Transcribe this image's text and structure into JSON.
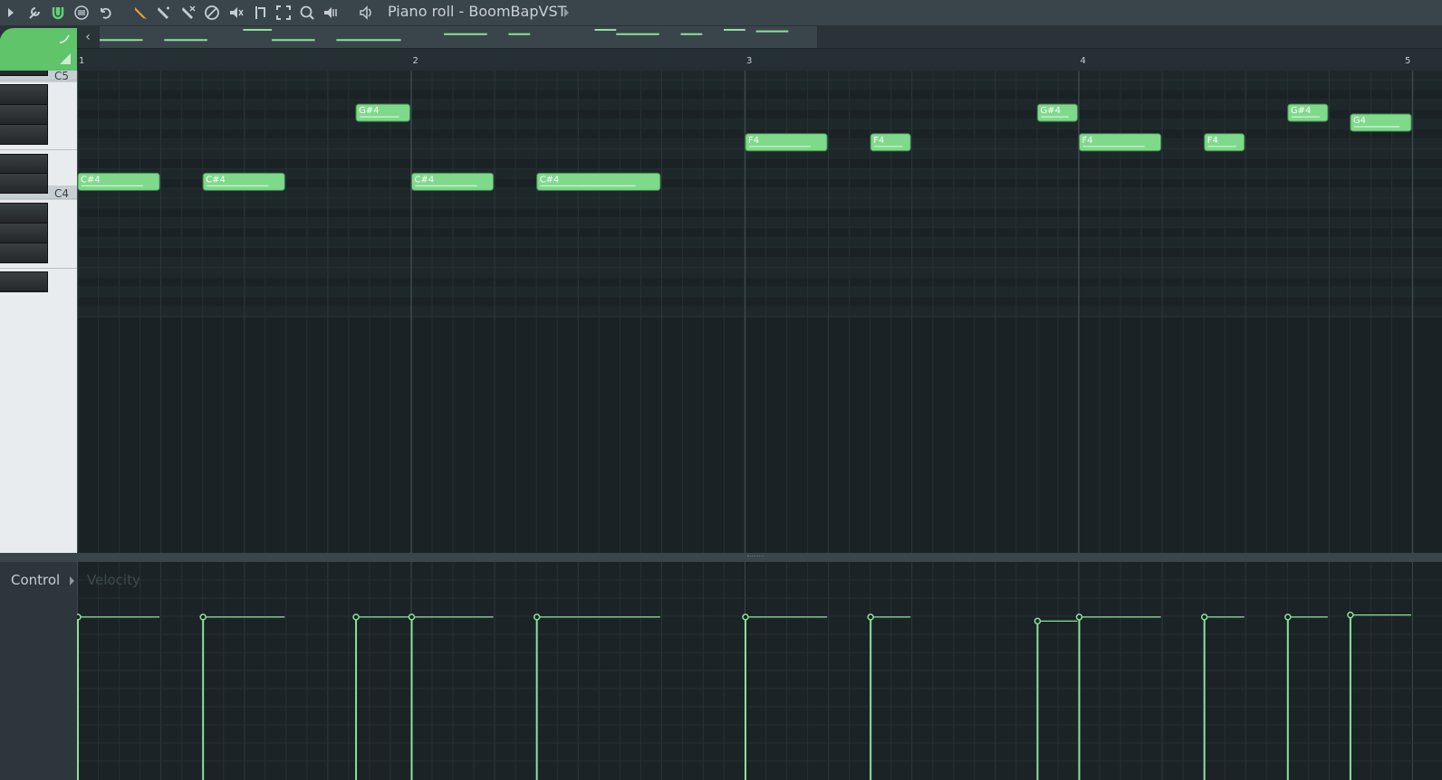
{
  "window": {
    "title": "Piano roll - BoomBapVST"
  },
  "toolbar": {
    "buttons": [
      {
        "name": "menu-arrow-icon"
      },
      {
        "name": "wrench-icon"
      },
      {
        "name": "magnet-icon"
      },
      {
        "name": "options-icon"
      },
      {
        "name": "undo-icon"
      },
      {
        "name": "pencil-icon"
      },
      {
        "name": "paint-icon"
      },
      {
        "name": "delete-icon"
      },
      {
        "name": "disable-icon"
      },
      {
        "name": "mute-icon"
      },
      {
        "name": "slice-icon"
      },
      {
        "name": "select-icon"
      },
      {
        "name": "zoom-icon"
      },
      {
        "name": "playback-icon"
      },
      {
        "name": "speaker-icon"
      }
    ]
  },
  "ruler": {
    "bars": [
      "1",
      "2",
      "3",
      "4",
      "5"
    ]
  },
  "keyboard": {
    "labels": [
      "C5",
      "C4"
    ]
  },
  "notes": [
    {
      "label": "C#4",
      "pitch": 61,
      "start": 0.0,
      "length": 0.25,
      "velocity": 0.8
    },
    {
      "label": "C#4",
      "pitch": 61,
      "start": 0.375,
      "length": 0.25,
      "velocity": 0.8
    },
    {
      "label": "G#4",
      "pitch": 68,
      "start": 0.8333,
      "length": 0.1667,
      "velocity": 0.8
    },
    {
      "label": "C#4",
      "pitch": 61,
      "start": 1.0,
      "length": 0.25,
      "velocity": 0.8
    },
    {
      "label": "C#4",
      "pitch": 61,
      "start": 1.375,
      "length": 0.375,
      "velocity": 0.8
    },
    {
      "label": "F4",
      "pitch": 65,
      "start": 2.0,
      "length": 0.25,
      "velocity": 0.8
    },
    {
      "label": "F4",
      "pitch": 65,
      "start": 2.375,
      "length": 0.125,
      "velocity": 0.8
    },
    {
      "label": "G#4",
      "pitch": 68,
      "start": 2.875,
      "length": 0.125,
      "velocity": 0.78
    },
    {
      "label": "F4",
      "pitch": 65,
      "start": 3.0,
      "length": 0.25,
      "velocity": 0.8
    },
    {
      "label": "F4",
      "pitch": 65,
      "start": 3.375,
      "length": 0.125,
      "velocity": 0.8
    },
    {
      "label": "G#4",
      "pitch": 68,
      "start": 3.625,
      "length": 0.125,
      "velocity": 0.8
    },
    {
      "label": "G4",
      "pitch": 67,
      "start": 3.8125,
      "length": 0.1875,
      "velocity": 0.81
    }
  ],
  "control": {
    "label": "Control",
    "target": "Velocity"
  },
  "colors": {
    "note_fill": "#7fd98b",
    "note_border": "#3f8e4c",
    "velocity_line": "#8be29a",
    "grid_bg": "#1a2225",
    "grid_bg_alt": "#1e272a",
    "grid_line": "#263033",
    "beat_line": "#2c373b",
    "bar_line": "#3b484d"
  }
}
